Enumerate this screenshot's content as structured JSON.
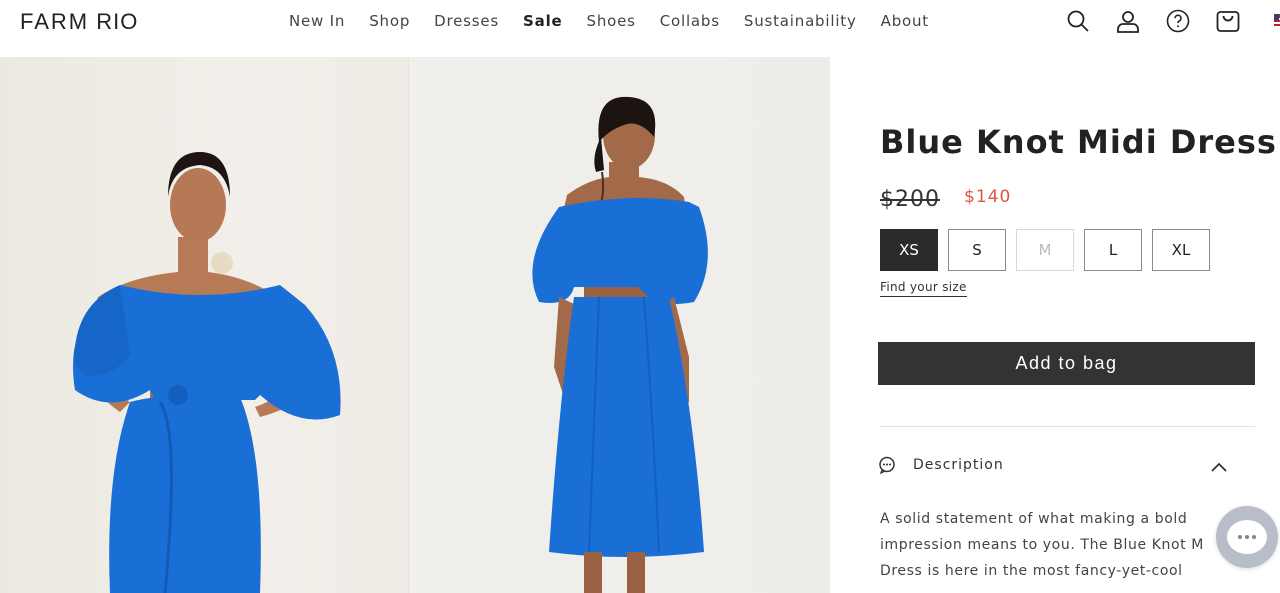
{
  "header": {
    "logo_main": "FARM",
    "logo_sub": "RIO",
    "nav": [
      "New In",
      "Shop",
      "Dresses",
      "Sale",
      "Shoes",
      "Collabs",
      "Sustainability",
      "About"
    ],
    "icons": [
      "search-icon",
      "account-icon",
      "help-icon",
      "bag-icon",
      "us-flag-icon"
    ]
  },
  "product": {
    "title": "Blue Knot Midi Dress",
    "price_original": "$200",
    "price_sale": "$140",
    "sizes": [
      "XS",
      "S",
      "M",
      "L",
      "XL"
    ],
    "selected_size": "XS",
    "unavailable_sizes": [
      "M"
    ],
    "find_size_label": "Find your size",
    "add_to_bag_label": "Add to bag",
    "description_label": "Description",
    "description_lines": [
      "A solid statement of what making a bold",
      "impression means to you. The Blue Knot M",
      "Dress is here in the most fancy-yet-cool"
    ]
  },
  "colors": {
    "sale_price": "#e0563c",
    "button_bg": "#333333",
    "dress_blue": "#1a6fd6"
  }
}
